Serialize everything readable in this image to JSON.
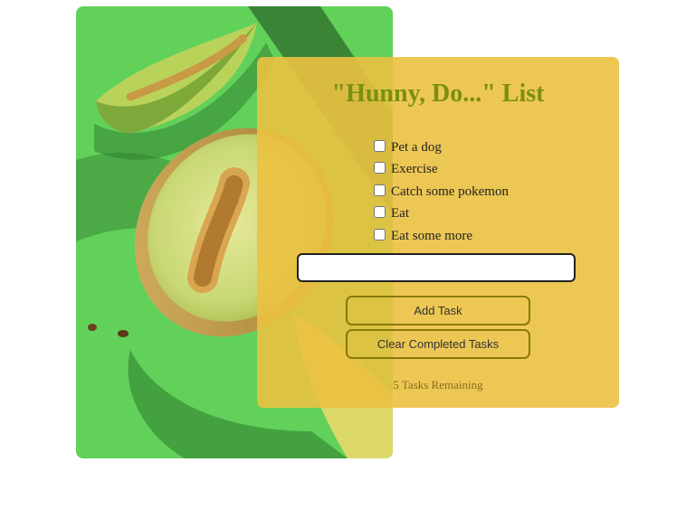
{
  "photo": {
    "subject": "cantaloupe melon slices on green background"
  },
  "app": {
    "title": "\"Hunny, Do...\" List",
    "tasks": [
      {
        "label": "Pet a dog",
        "checked": false
      },
      {
        "label": "Exercise",
        "checked": false
      },
      {
        "label": "Catch some pokemon",
        "checked": false
      },
      {
        "label": "Eat",
        "checked": false
      },
      {
        "label": "Eat some more",
        "checked": false
      }
    ],
    "new_task_value": "",
    "add_button": "Add Task",
    "clear_button": "Clear Completed Tasks",
    "remaining_text": "5 Tasks Remaining"
  },
  "colors": {
    "card_bg": "#ebc141",
    "title": "#7a8f10",
    "photo_bg": "#5fcf58"
  }
}
